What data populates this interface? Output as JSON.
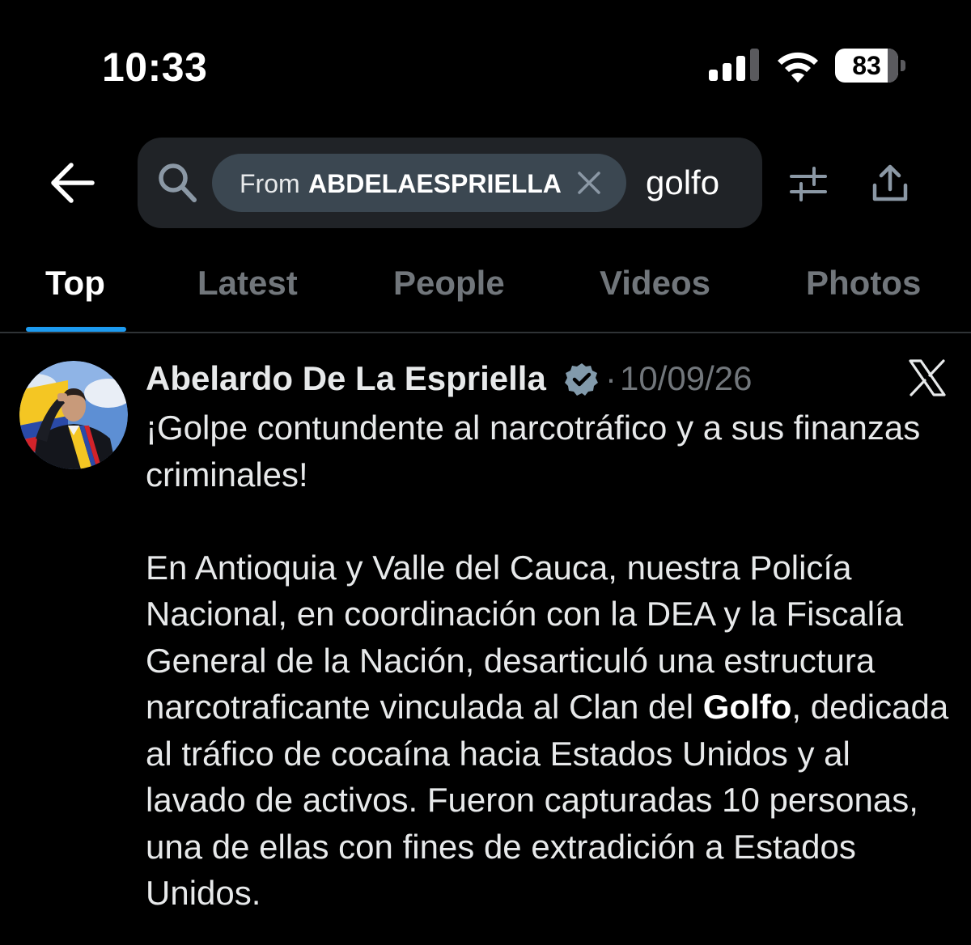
{
  "status_bar": {
    "time": "10:33",
    "battery_level": "83",
    "battery_fraction": 0.83,
    "signal_bars_active": 3,
    "signal_bars_total": 4
  },
  "search": {
    "filter_prefix": "From",
    "filter_user": "ABDELAESPRIELLA",
    "query": "golfo"
  },
  "tabs": [
    {
      "label": "Top",
      "active": true
    },
    {
      "label": "Latest",
      "active": false
    },
    {
      "label": "People",
      "active": false
    },
    {
      "label": "Videos",
      "active": false
    },
    {
      "label": "Photos",
      "active": false
    }
  ],
  "tweet": {
    "author_name": "Abelardo De La Espriella",
    "separator": "·",
    "date": "10/09/26",
    "paragraph1": "¡Golpe contundente al narcotráfico y a sus finanzas criminales!",
    "paragraph2_before": "En Antioquia y Valle del Cauca, nuestra Policía Nacional, en coordinación con la DEA y la Fiscalía General de la Nación, desarticuló una estructura narcotraficante vinculada al Clan del ",
    "paragraph2_highlight": "Golfo",
    "paragraph2_after": ", dedicada al tráfico de cocaína hacia Estados Unidos y al lavado de activos. Fueron capturadas 10 personas, una de ellas con fines de extradición a Estados Unidos."
  },
  "colors": {
    "background": "#000000",
    "accent": "#1d9bf0",
    "muted": "#71767b",
    "search_box": "#202327",
    "chip": "#3b4751"
  }
}
